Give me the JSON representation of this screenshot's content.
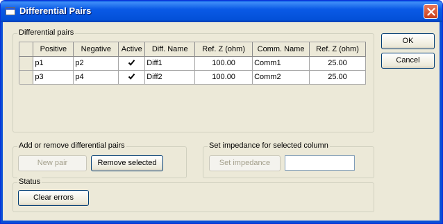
{
  "window": {
    "title": "Differential Pairs"
  },
  "groups": {
    "pairs_label": "Differential pairs",
    "add_remove_label": "Add or remove differential pairs",
    "impedance_label": "Set impedance for selected column",
    "status_label": "Status"
  },
  "table": {
    "headers": [
      "Positive",
      "Negative",
      "Active",
      "Diff. Name",
      "Ref. Z (ohm)",
      "Comm. Name",
      "Ref. Z (ohm)"
    ],
    "rows": [
      {
        "positive": "p1",
        "negative": "p2",
        "active": true,
        "diff_name": "Diff1",
        "ref_z_diff": "100.00",
        "comm_name": "Comm1",
        "ref_z_comm": "25.00"
      },
      {
        "positive": "p3",
        "negative": "p4",
        "active": true,
        "diff_name": "Diff2",
        "ref_z_diff": "100.00",
        "comm_name": "Comm2",
        "ref_z_comm": "25.00"
      }
    ]
  },
  "buttons": {
    "ok": "OK",
    "cancel": "Cancel",
    "new_pair": "New pair",
    "remove_selected": "Remove selected",
    "set_impedance": "Set impedance",
    "clear_errors": "Clear errors"
  },
  "impedance_input": {
    "value": ""
  },
  "colors": {
    "titlebar": "#0a5ae6",
    "dialog_bg": "#ece9d8",
    "close_button": "#d9502c"
  }
}
